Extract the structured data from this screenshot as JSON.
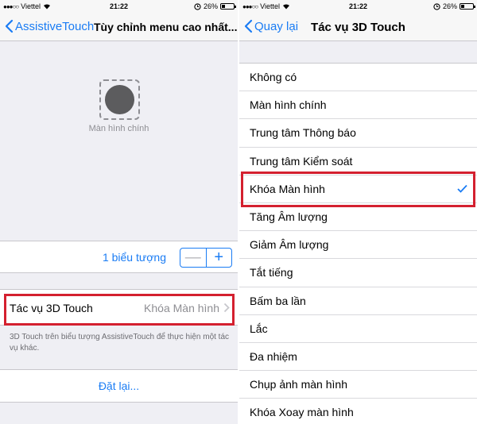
{
  "status": {
    "carrier": "Viettel",
    "time": "21:22",
    "battery": "26%",
    "battery_level": 0.26
  },
  "left": {
    "back_label": "AssistiveTouch",
    "title": "Tùy chỉnh menu cao nhất...",
    "icon_label": "Màn hình chính",
    "icon_count_label": "1 biểu tượng",
    "stepper_minus": "—",
    "stepper_plus": "+",
    "touch_label": "Tác vụ 3D Touch",
    "touch_value": "Khóa Màn hình",
    "footnote": "3D Touch trên biểu tượng AssistiveTouch để thực hiện một tác vụ khác.",
    "reset_label": "Đặt lại..."
  },
  "right": {
    "back_label": "Quay lại",
    "title": "Tác vụ 3D Touch",
    "selected_item": "Khóa Màn hình",
    "items": [
      "Không có",
      "Màn hình chính",
      "Trung tâm Thông báo",
      "Trung tâm Kiểm soát",
      "Khóa Màn hình",
      "Tăng Âm lượng",
      "Giảm Âm lượng",
      "Tắt tiếng",
      "Bấm ba lần",
      "Lắc",
      "Đa nhiệm",
      "Chụp ảnh màn hình",
      "Khóa Xoay màn hình"
    ]
  },
  "colors": {
    "accent": "#1a7cf4",
    "highlight": "#d4202f"
  }
}
